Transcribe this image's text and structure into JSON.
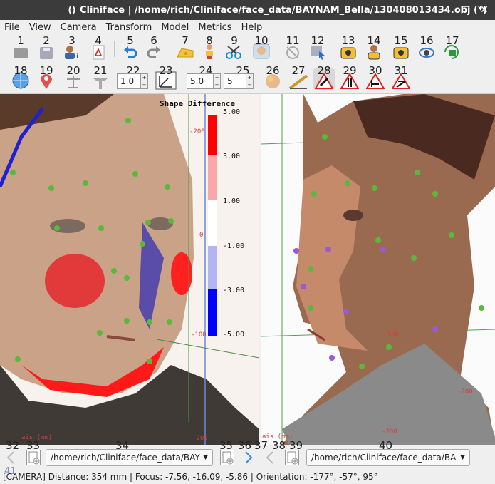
{
  "window": {
    "title": "Cliniface | /home/rich/Cliniface/face_data/BAYNAM_Bella/130408013434.obj (*)",
    "icon": "()",
    "controls": [
      "–",
      "□",
      "✕"
    ]
  },
  "menu": [
    "File",
    "View",
    "Camera",
    "Transform",
    "Model",
    "Metrics",
    "Help"
  ],
  "toolbar1": [
    {
      "num": "1",
      "icon": "open-folder-icon"
    },
    {
      "num": "2",
      "icon": "save-icon"
    },
    {
      "num": "3",
      "icon": "patient-info-icon"
    },
    {
      "num": "4",
      "icon": "pdf-report-icon"
    },
    {
      "num": "5",
      "icon": "undo-icon"
    },
    {
      "num": "6",
      "icon": "redo-icon"
    },
    {
      "num": "7",
      "icon": "cheese-icon"
    },
    {
      "num": "8",
      "icon": "paint-person-icon"
    },
    {
      "num": "9",
      "icon": "scissors-icon"
    },
    {
      "num": "10",
      "icon": "face-mask-icon"
    },
    {
      "num": "11",
      "icon": "align-disabled-icon"
    },
    {
      "num": "12",
      "icon": "select-cursor-icon"
    },
    {
      "num": "13",
      "icon": "camera-screenshot-icon"
    },
    {
      "num": "14",
      "icon": "person-camera-icon"
    },
    {
      "num": "15",
      "icon": "camera-alt-icon"
    },
    {
      "num": "16",
      "icon": "camera-rotate-icon"
    },
    {
      "num": "17",
      "icon": "video-record-icon"
    }
  ],
  "toolbar2": [
    {
      "num": "18",
      "icon": "globe-icon"
    },
    {
      "num": "19",
      "icon": "landmark-pin-icon"
    },
    {
      "num": "20",
      "icon": "balance-scale-icon"
    },
    {
      "num": "21",
      "icon": "symmetry-plane-icon"
    },
    {
      "num": "22",
      "icon": "spin-value-a"
    },
    {
      "num": "23",
      "icon": "axes-xyz-icon"
    },
    {
      "num": "24",
      "icon": "spin-value-b"
    },
    {
      "num": "25",
      "icon": "spin-value-c"
    },
    {
      "num": "26",
      "icon": "head-brain-icon"
    },
    {
      "num": "27",
      "icon": "ruler-angle-icon"
    },
    {
      "num": "28",
      "icon": "warn-measure-a-icon"
    },
    {
      "num": "29",
      "icon": "warn-measure-b-icon"
    },
    {
      "num": "30",
      "icon": "warn-measure-c-icon"
    },
    {
      "num": "31",
      "icon": "warn-measure-d-icon"
    }
  ],
  "spinboxes": {
    "a": "1.0",
    "b": "5.0",
    "c": "5"
  },
  "legend": {
    "title": "Shape Difference",
    "labels": [
      "5.00",
      "3.00",
      "1.00",
      "-1.00",
      "-3.00",
      "-5.00"
    ],
    "colors": [
      "#ff0000",
      "#f8a8a8",
      "#ffffff",
      "#b4b4f4",
      "#0000ff"
    ]
  },
  "overlay_labels": {
    "left": [
      "-200",
      "-100",
      "0",
      "ais (mm)",
      "-200"
    ],
    "right": [
      "-100",
      "-200",
      "-200",
      "ais (mm)"
    ]
  },
  "bottom": {
    "nums": [
      "32",
      "33",
      "34",
      "35",
      "36",
      "37",
      "38",
      "39",
      "40"
    ],
    "left_path": "/home/rich/Cliniface/face_data/BAY",
    "right_path": "/home/rich/Cliniface/face_data/BA"
  },
  "status": {
    "num": "41",
    "text": "[CAMERA]  Distance: 354 mm  |  Focus: -7.56, -16.09, -5.86  |  Orientation: -177°, -57°, 95°"
  }
}
